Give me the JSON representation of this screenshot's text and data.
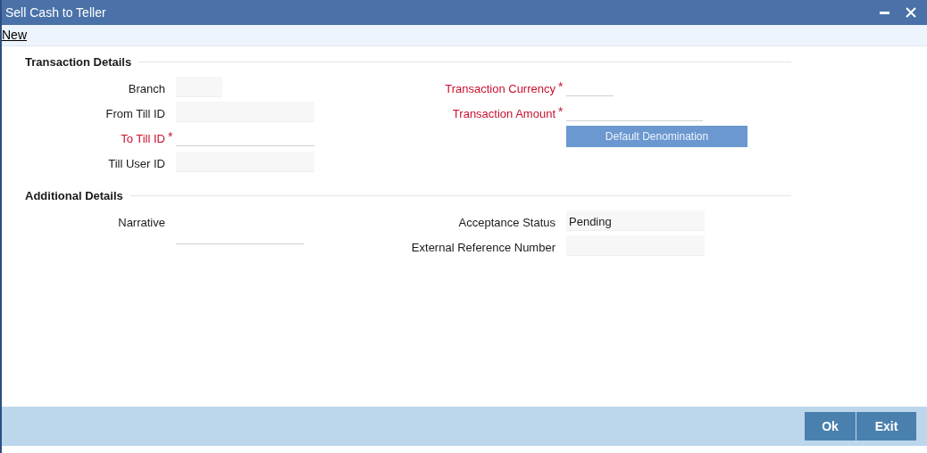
{
  "window": {
    "title": "Sell Cash to Teller"
  },
  "toolbar": {
    "new_link": "New"
  },
  "sections": [
    {
      "title": "Transaction Details",
      "left": [
        {
          "label": "Branch",
          "kind": "readonly",
          "required": false
        },
        {
          "label": "From Till ID",
          "kind": "readonly",
          "required": false
        },
        {
          "label": "To Till ID",
          "kind": "input",
          "required": true,
          "required_mark": "*"
        },
        {
          "label": "Till User ID",
          "kind": "readonly",
          "required": false
        }
      ],
      "right": [
        {
          "label": "Transaction Currency",
          "kind": "input",
          "required": true,
          "required_mark": "*"
        },
        {
          "label": "Transaction Amount",
          "kind": "input",
          "required": true,
          "required_mark": "*"
        },
        {
          "label": "Default Denomination",
          "kind": "button"
        }
      ]
    },
    {
      "title": "Additional Details",
      "left": [
        {
          "label": "Narrative",
          "kind": "textarea",
          "required": false
        }
      ],
      "right": [
        {
          "label": "Acceptance Status",
          "kind": "readonly",
          "required": false,
          "value": "Pending"
        },
        {
          "label": "External Reference Number",
          "kind": "readonly",
          "required": false
        }
      ]
    }
  ],
  "footer": {
    "buttons": [
      "Ok",
      "Exit"
    ]
  }
}
